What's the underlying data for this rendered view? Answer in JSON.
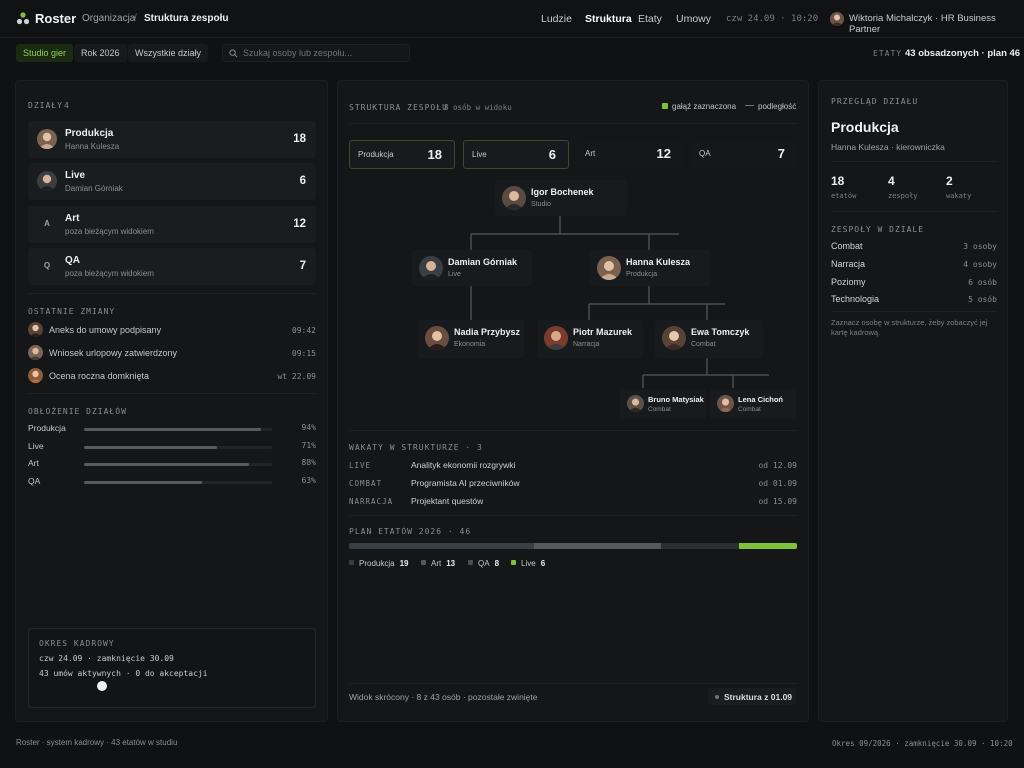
{
  "app": {
    "name": "Roster"
  },
  "breadcrumb": {
    "parent": "Organizacja",
    "sep": "/",
    "current": "Struktura zespołu"
  },
  "nav": {
    "items": [
      "Ludzie",
      "Struktura",
      "Etaty",
      "Umowy"
    ],
    "active": "Struktura"
  },
  "datetime": "czw 24.09 · 10:20",
  "user": {
    "label": "Wiktoria Michalczyk · HR Business Partner"
  },
  "filters": {
    "studio": "Studio gier",
    "year": "Rok 2026",
    "depts": "Wszystkie działy"
  },
  "search": {
    "placeholder": "Szukaj osoby lub zespołu..."
  },
  "headcount": {
    "label": "ETATY",
    "value": "43 obsadzonych · plan 46"
  },
  "colors": {
    "accent": "#7fc23a",
    "bg": "#0f1112",
    "panel": "#141617"
  },
  "departments": {
    "label": "DZIAŁY",
    "count": "4",
    "items": [
      {
        "name": "Produkcja",
        "sub": "Hanna Kulesza",
        "count": "18",
        "icon": "avatar"
      },
      {
        "name": "Live",
        "sub": "Damian Górniak",
        "count": "6",
        "icon": "avatar"
      },
      {
        "name": "Art",
        "sub": "poza bieżącym widokiem",
        "count": "12",
        "icon": "A"
      },
      {
        "name": "QA",
        "sub": "poza bieżącym widokiem",
        "count": "7",
        "icon": "Q"
      }
    ]
  },
  "changes": {
    "label": "OSTATNIE ZMIANY",
    "items": [
      {
        "text": "Aneks do umowy podpisany",
        "time": "09:42"
      },
      {
        "text": "Wniosek urlopowy zatwierdzony",
        "time": "09:15"
      },
      {
        "text": "Ocena roczna domknięta",
        "time": "wt 22.09"
      }
    ]
  },
  "load": {
    "label": "OBŁOŻENIE DZIAŁÓW",
    "items": [
      {
        "name": "Produkcja",
        "pct": "94%",
        "value": 0.94
      },
      {
        "name": "Live",
        "pct": "71%",
        "value": 0.71
      },
      {
        "name": "Art",
        "pct": "88%",
        "value": 0.88
      },
      {
        "name": "QA",
        "pct": "63%",
        "value": 0.63
      }
    ]
  },
  "period": {
    "label": "OKRES KADROWY",
    "line1": "czw 24.09 · zamknięcie 30.09",
    "line2": "43 umów aktywnych · 0 do akceptacji"
  },
  "structure": {
    "label": "STRUKTURA ZESPOŁU",
    "count": "8 osób w widoku",
    "legend_selected": "gałąź zaznaczona",
    "legend_sub": "podległość",
    "tiles": [
      {
        "name": "Produkcja",
        "value": "18",
        "selected": true
      },
      {
        "name": "Live",
        "value": "6",
        "selected": true
      },
      {
        "name": "Art",
        "value": "12",
        "selected": false
      },
      {
        "name": "QA",
        "value": "7",
        "selected": false
      }
    ],
    "nodes": {
      "root": {
        "name": "Igor Bochenek",
        "role": "Studio"
      },
      "damian": {
        "name": "Damian Górniak",
        "role": "Live"
      },
      "hanna": {
        "name": "Hanna Kulesza",
        "role": "Produkcja"
      },
      "nadia": {
        "name": "Nadia Przybysz",
        "role": "Ekonomia"
      },
      "piotr": {
        "name": "Piotr Mazurek",
        "role": "Narracja"
      },
      "ewa": {
        "name": "Ewa Tomczyk",
        "role": "Combat"
      },
      "bruno": {
        "name": "Bruno Matysiak",
        "role": "Combat"
      },
      "lena": {
        "name": "Lena Cichoń",
        "role": "Combat"
      }
    },
    "footer_left": "Widok skrócony · 8 z 43 osób · pozostałe zwinięte",
    "footer_right": "Struktura z 01.09"
  },
  "vacancies": {
    "label": "WAKATY W STRUKTURZE · 3",
    "items": [
      {
        "dept": "LIVE",
        "title": "Analityk ekonomii rozgrywki",
        "date": "od 12.09"
      },
      {
        "dept": "COMBAT",
        "title": "Programista AI przeciwników",
        "date": "od 01.09"
      },
      {
        "dept": "NARRACJA",
        "title": "Projektant questów",
        "date": "od 15.09"
      }
    ]
  },
  "plan": {
    "label": "PLAN ETATÓW 2026 · 46",
    "items": [
      {
        "name": "Produkcja",
        "value": 19,
        "label": "19",
        "color": "#3a3f43"
      },
      {
        "name": "Art",
        "value": 13,
        "label": "13",
        "color": "#55595c"
      },
      {
        "name": "QA",
        "value": 8,
        "label": "8",
        "color": "#2b2e31"
      },
      {
        "name": "Live",
        "value": 6,
        "label": "6",
        "color": "#7fc23a"
      }
    ]
  },
  "overview": {
    "label": "PRZEGLĄD DZIAŁU",
    "title": "Produkcja",
    "sub": "Hanna Kulesza · kierowniczka",
    "stats": [
      {
        "value": "18",
        "label": "etatów"
      },
      {
        "value": "4",
        "label": "zespoły"
      },
      {
        "value": "2",
        "label": "wakaty"
      }
    ],
    "teams_label": "ZESPOŁY W DZIALE",
    "teams": [
      {
        "name": "Combat",
        "count": "3 osoby"
      },
      {
        "name": "Narracja",
        "count": "4 osoby"
      },
      {
        "name": "Poziomy",
        "count": "6 osób"
      },
      {
        "name": "Technologia",
        "count": "5 osób"
      }
    ],
    "hint": "Zaznacz osobę w strukturze, żeby zobaczyć jej kartę kadrową."
  },
  "footer": {
    "left": "Roster · system kadrowy · 43 etatów w studiu",
    "right": "Okres 09/2026 · zamknięcie 30.09 · 10:20"
  }
}
